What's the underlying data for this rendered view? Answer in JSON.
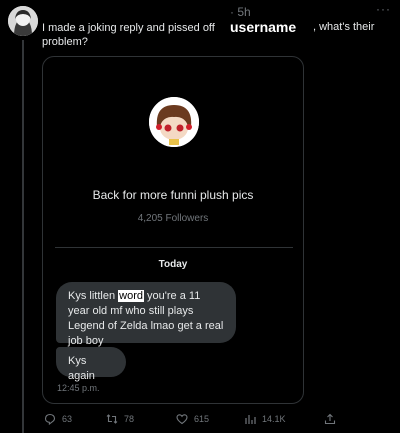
{
  "post": {
    "time_ago": "· 5h",
    "username": "username",
    "text": "I made a joking reply and pissed off",
    "text_line2": "problem?",
    "text_tail": ", what's their",
    "more_icon": "more-icon"
  },
  "card": {
    "bio": "Back for more funni plush pics",
    "followers": "4,205 Followers",
    "date_label": "Today",
    "messages": [
      {
        "pre": "Kys littlen ",
        "highlight": "word",
        "post": " you're a 11 year old mf who still plays Legend of Zelda lmao get a real job boy"
      },
      {
        "text": "Kys again"
      }
    ],
    "msg_time": "12:45 p.m."
  },
  "actions": {
    "replies": "63",
    "reposts": "78",
    "likes": "615",
    "views": "14.1K"
  },
  "colors": {
    "background": "#000000",
    "bubble": "#2f3336",
    "muted": "#71767b",
    "text": "#e7e9ea"
  }
}
